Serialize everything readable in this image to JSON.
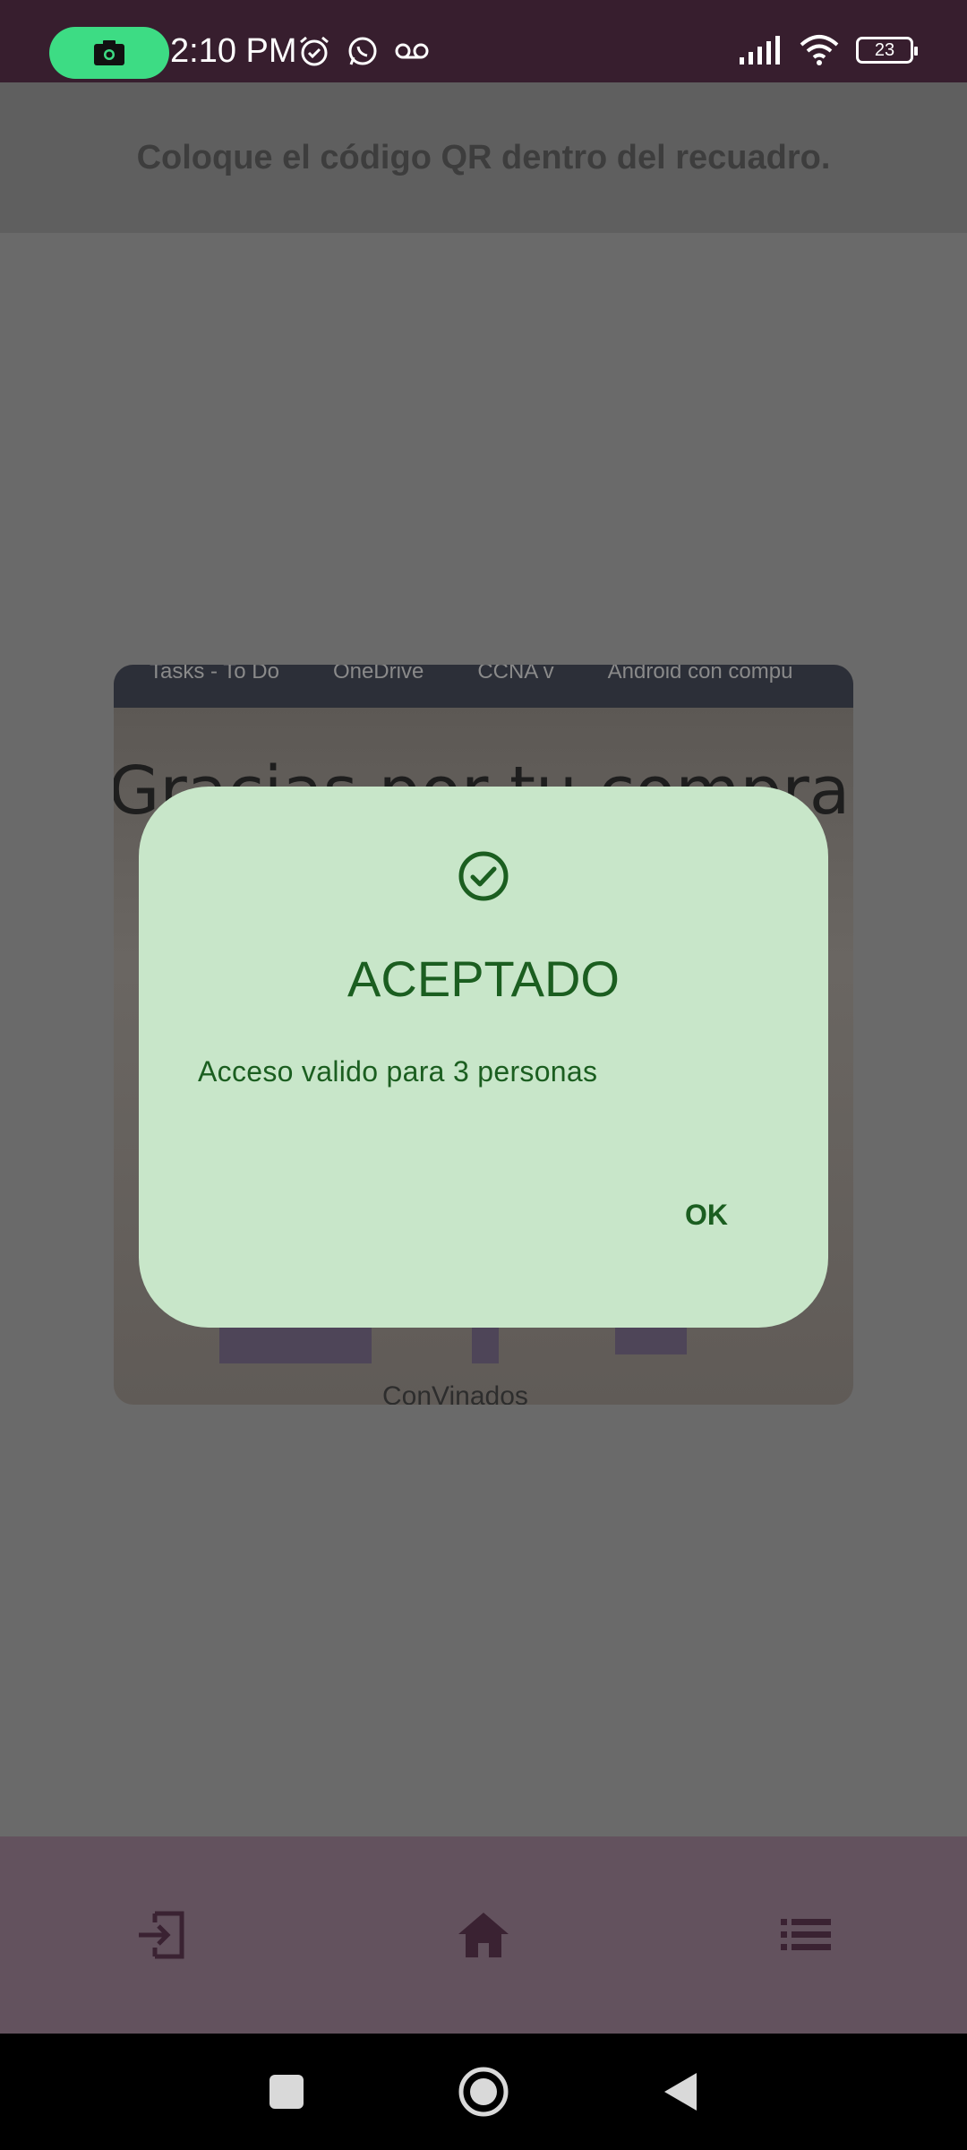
{
  "status_bar": {
    "time": "2:10 PM",
    "battery": "23",
    "icons_left": [
      "alarm-icon",
      "whatsapp-icon",
      "voicemail-icon"
    ],
    "icons_right": [
      "signal-icon",
      "wifi-icon",
      "battery-icon"
    ],
    "camera_indicator_color": "#3ddc84"
  },
  "header": {
    "title": "Coloque el código QR dentro del recuadro."
  },
  "camera_preview": {
    "tabs": [
      "Tasks - To Do",
      "OneDrive",
      "CCNA v",
      "Android con compu"
    ],
    "title_text": "Gracias por tu compra!",
    "footer_text": "ConVinados"
  },
  "dialog": {
    "icon": "check-circle-icon",
    "title": "ACEPTADO",
    "message": "Acceso valido para 3 personas",
    "ok_label": "OK",
    "background": "#c8e6c9",
    "accent": "#1b5e20"
  },
  "bottom_nav": {
    "items": [
      "logout-icon",
      "home-icon",
      "list-icon"
    ]
  },
  "system_nav": {
    "items": [
      "recents-button",
      "home-button",
      "back-button"
    ]
  }
}
